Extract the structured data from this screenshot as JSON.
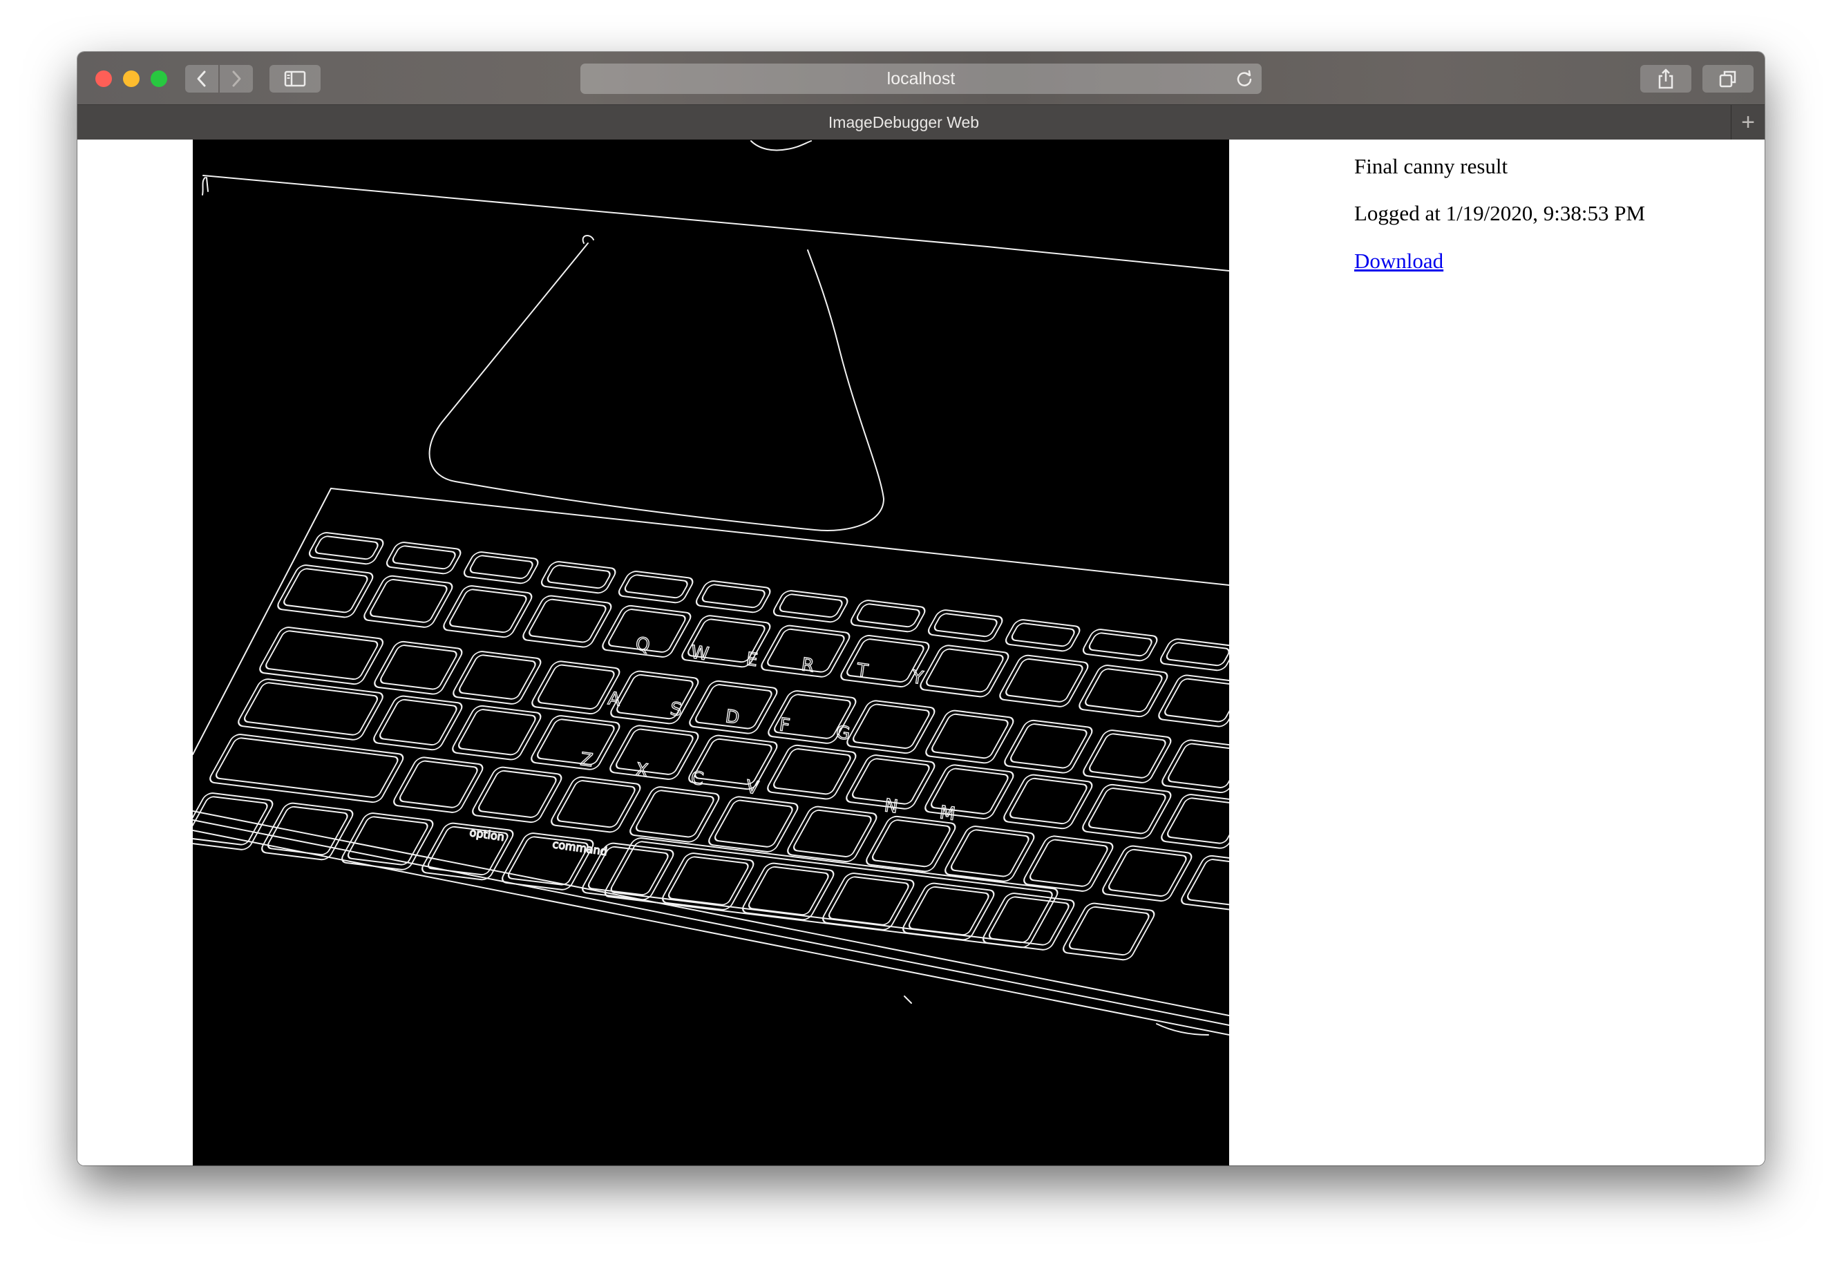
{
  "browser": {
    "url": "localhost",
    "tab_title": "ImageDebugger Web",
    "icons": {
      "close": "close-icon",
      "minimize": "minimize-icon",
      "maximize": "maximize-icon",
      "back": "chevron-left-icon",
      "forward": "chevron-right-icon",
      "sidebar": "sidebar-icon",
      "reload": "reload-icon",
      "share": "share-icon",
      "tabs": "tabs-overview-icon",
      "new_tab": "plus-icon"
    }
  },
  "page": {
    "title": "Final canny result",
    "logged": "Logged at 1/19/2020, 9:38:53 PM",
    "download_label": "Download"
  },
  "image": {
    "keycaps": [
      "Q",
      "W",
      "E",
      "R",
      "T",
      "Y",
      "A",
      "S",
      "D",
      "F",
      "G",
      "Z",
      "X",
      "C",
      "V",
      "N",
      "M",
      "option",
      "command"
    ]
  }
}
